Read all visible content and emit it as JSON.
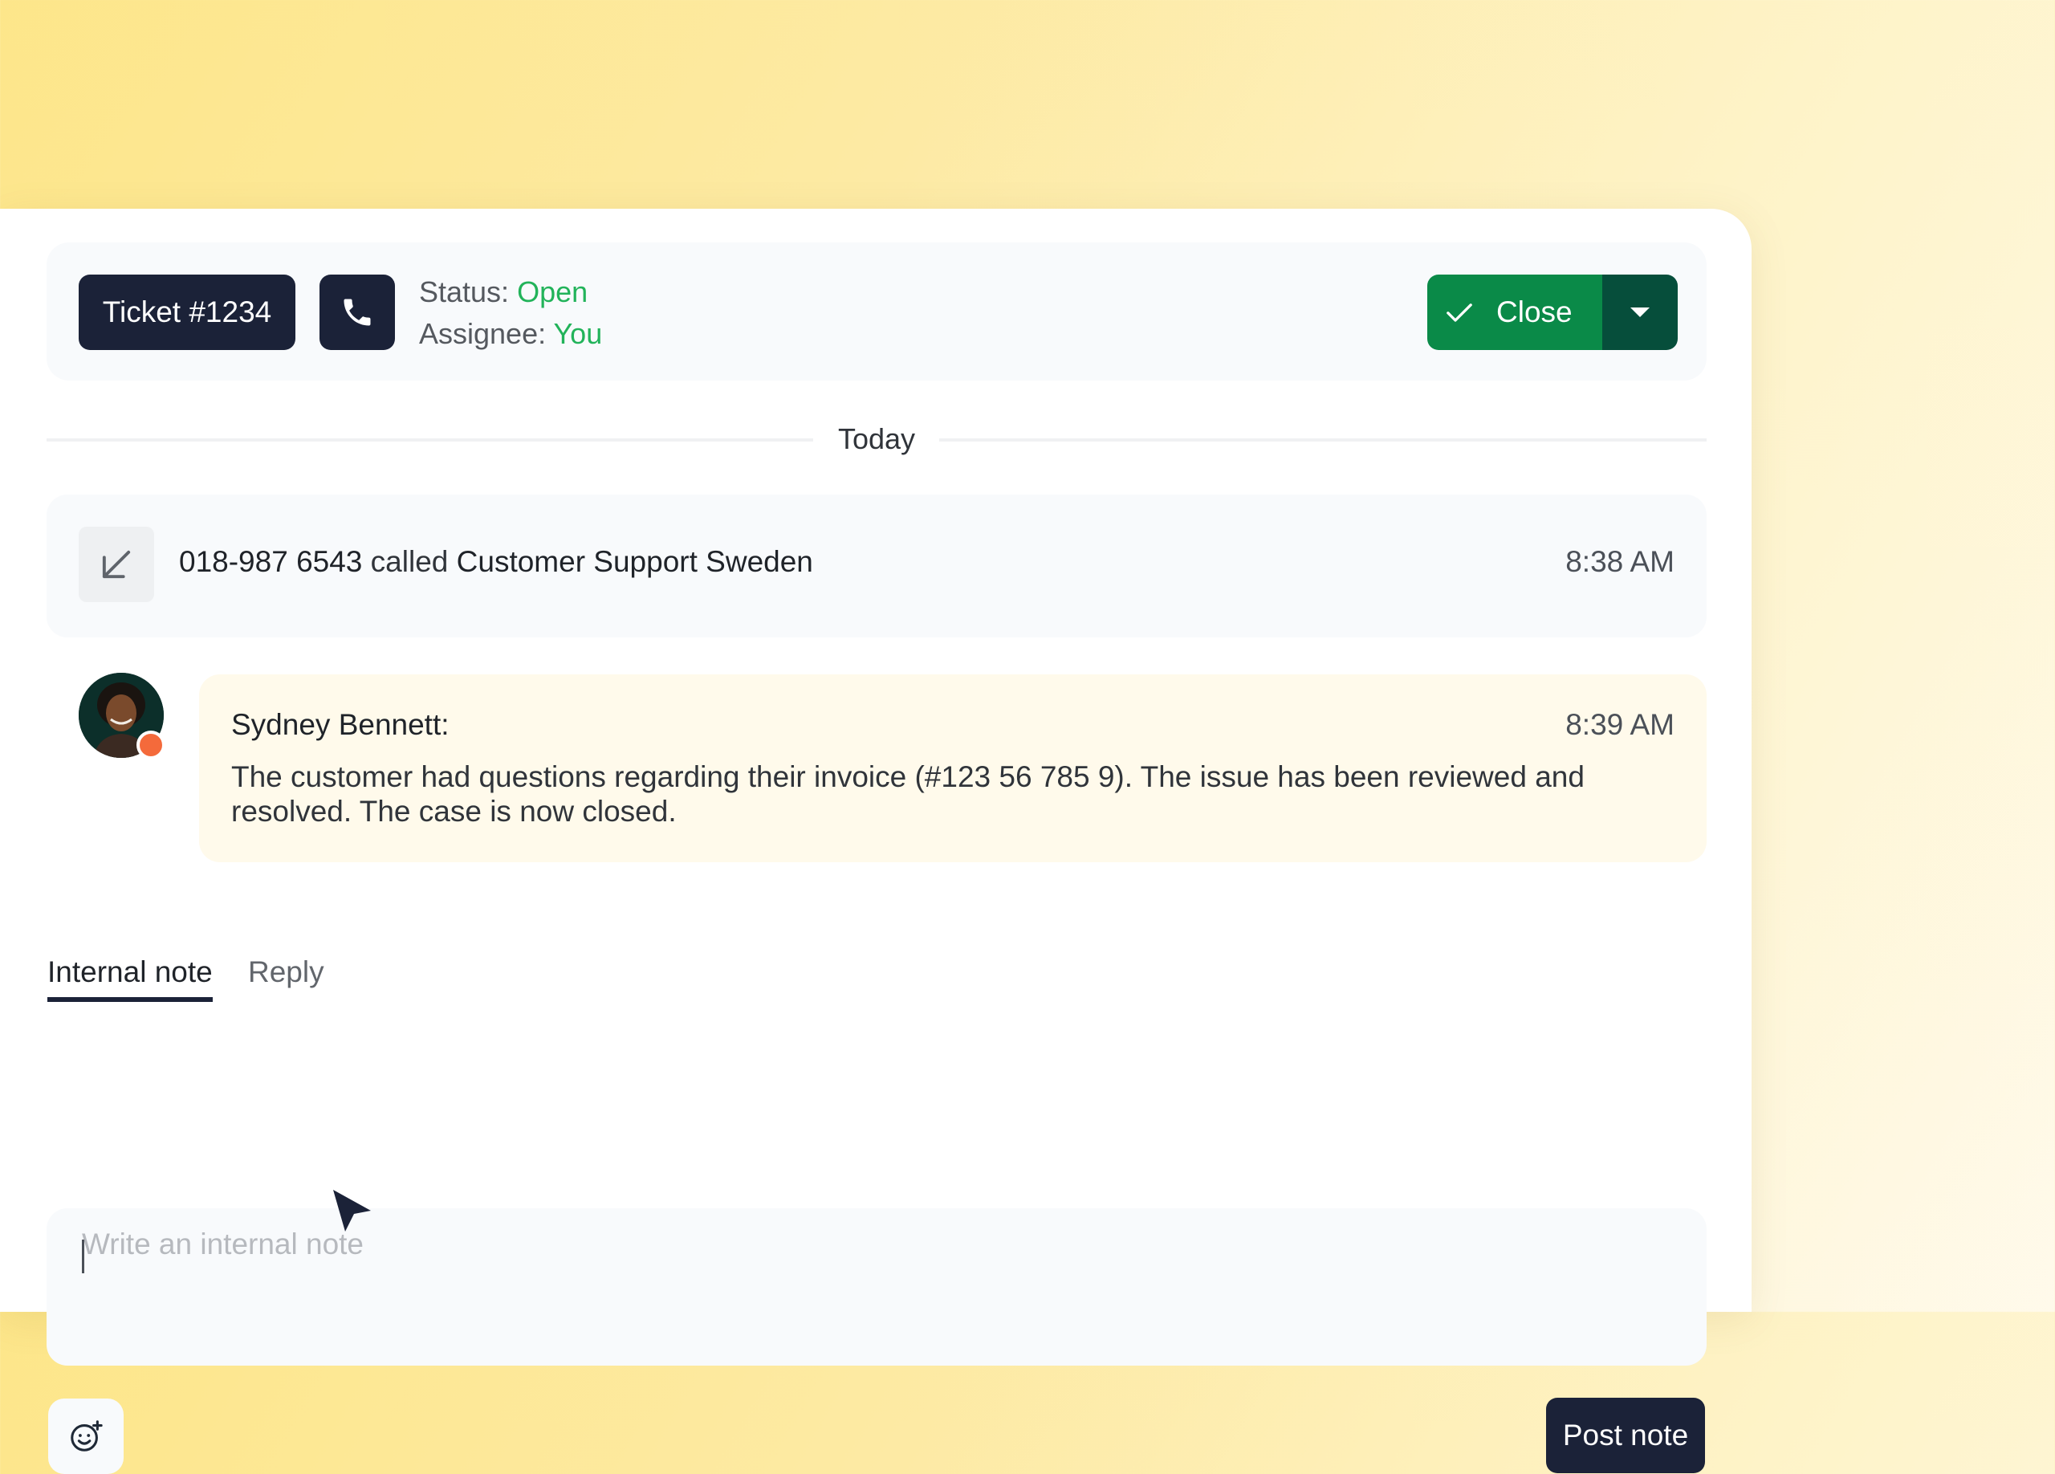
{
  "ticket": {
    "label": "Ticket #1234",
    "status_label": "Status:",
    "status_value": "Open",
    "assignee_label": "Assignee:",
    "assignee_value": "You",
    "close_label": "Close"
  },
  "timeline": {
    "divider_label": "Today",
    "call": {
      "number": "018-987 6543",
      "verb": "called",
      "target": "Customer Support Sweden",
      "time": "8:38 AM"
    },
    "note": {
      "author": "Sydney Bennett:",
      "time": "8:39 AM",
      "text": "The customer had questions regarding their invoice (#123 56 785 9). The issue has been reviewed and resolved. The case is now closed."
    }
  },
  "composer": {
    "tabs": [
      {
        "label": "Internal note",
        "active": true
      },
      {
        "label": "Reply",
        "active": false
      }
    ],
    "placeholder": "Write an internal note",
    "value": "",
    "post_label": "Post note"
  },
  "icons": [
    "phone-icon",
    "check-icon",
    "caret-down-icon",
    "arrow-down-left-icon",
    "emoji-add-icon",
    "pointer-cursor-icon"
  ],
  "colors": {
    "dark": "#1b2238",
    "green_text": "#22b35a",
    "close_green": "#0a8a48",
    "close_dark": "#064e3b",
    "status_dot": "#f46a3b",
    "note_bg": "#fffaeb"
  }
}
